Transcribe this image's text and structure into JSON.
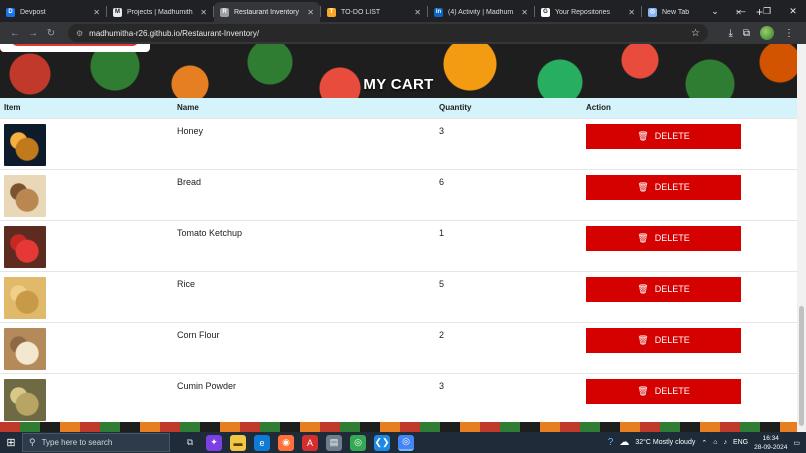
{
  "browser": {
    "tabs": [
      {
        "label": "Devpost",
        "icon": "D",
        "icon_color": "#1a73e8",
        "active": false
      },
      {
        "label": "Projects | Madhumith",
        "icon": "M",
        "icon_color": "#e8eaed",
        "active": false
      },
      {
        "label": "Restaurant Inventory",
        "icon": "R",
        "icon_color": "#9aa0a6",
        "active": true
      },
      {
        "label": "TO-DO LIST",
        "icon": "T",
        "icon_color": "#f9a825",
        "active": false
      },
      {
        "label": "(4) Activity | Madhum",
        "icon": "in",
        "icon_color": "#0a66c2",
        "active": false
      },
      {
        "label": "Your Repositories",
        "icon": "G",
        "icon_color": "#ffffff",
        "active": false
      },
      {
        "label": "New Tab",
        "icon": "◎",
        "icon_color": "#8ab4f8",
        "active": false
      }
    ],
    "new_tab_glyph": "+",
    "url": "madhumitha-r26.github.io/Restaurant-Inventory/"
  },
  "page": {
    "title": "MY CART",
    "columns": [
      "Item",
      "Name",
      "Quantity",
      "Action"
    ],
    "delete_label": "DELETE",
    "items": [
      {
        "name": "Honey",
        "quantity": "3",
        "img_colors": [
          "#0d1b2a",
          "#c07a1c",
          "#f5b041"
        ]
      },
      {
        "name": "Bread",
        "quantity": "6",
        "img_colors": [
          "#e8d8b8",
          "#b9874f",
          "#7a5230"
        ]
      },
      {
        "name": "Tomato Ketchup",
        "quantity": "1",
        "img_colors": [
          "#5d2b1f",
          "#e53935",
          "#c62828"
        ]
      },
      {
        "name": "Rice",
        "quantity": "5",
        "img_colors": [
          "#e0b96a",
          "#c89a48",
          "#f0cf8a"
        ]
      },
      {
        "name": "Corn Flour",
        "quantity": "2",
        "img_colors": [
          "#b48a5a",
          "#f3e7cf",
          "#8d6a44"
        ]
      },
      {
        "name": "Cumin Powder",
        "quantity": "3",
        "img_colors": [
          "#6e6a44",
          "#b8a464",
          "#d8c98a"
        ]
      }
    ]
  },
  "taskbar": {
    "search_placeholder": "Type here to search",
    "weather": "32°C  Mostly cloudy",
    "language": "ENG",
    "time": "16:34",
    "date": "28-09-2024"
  }
}
